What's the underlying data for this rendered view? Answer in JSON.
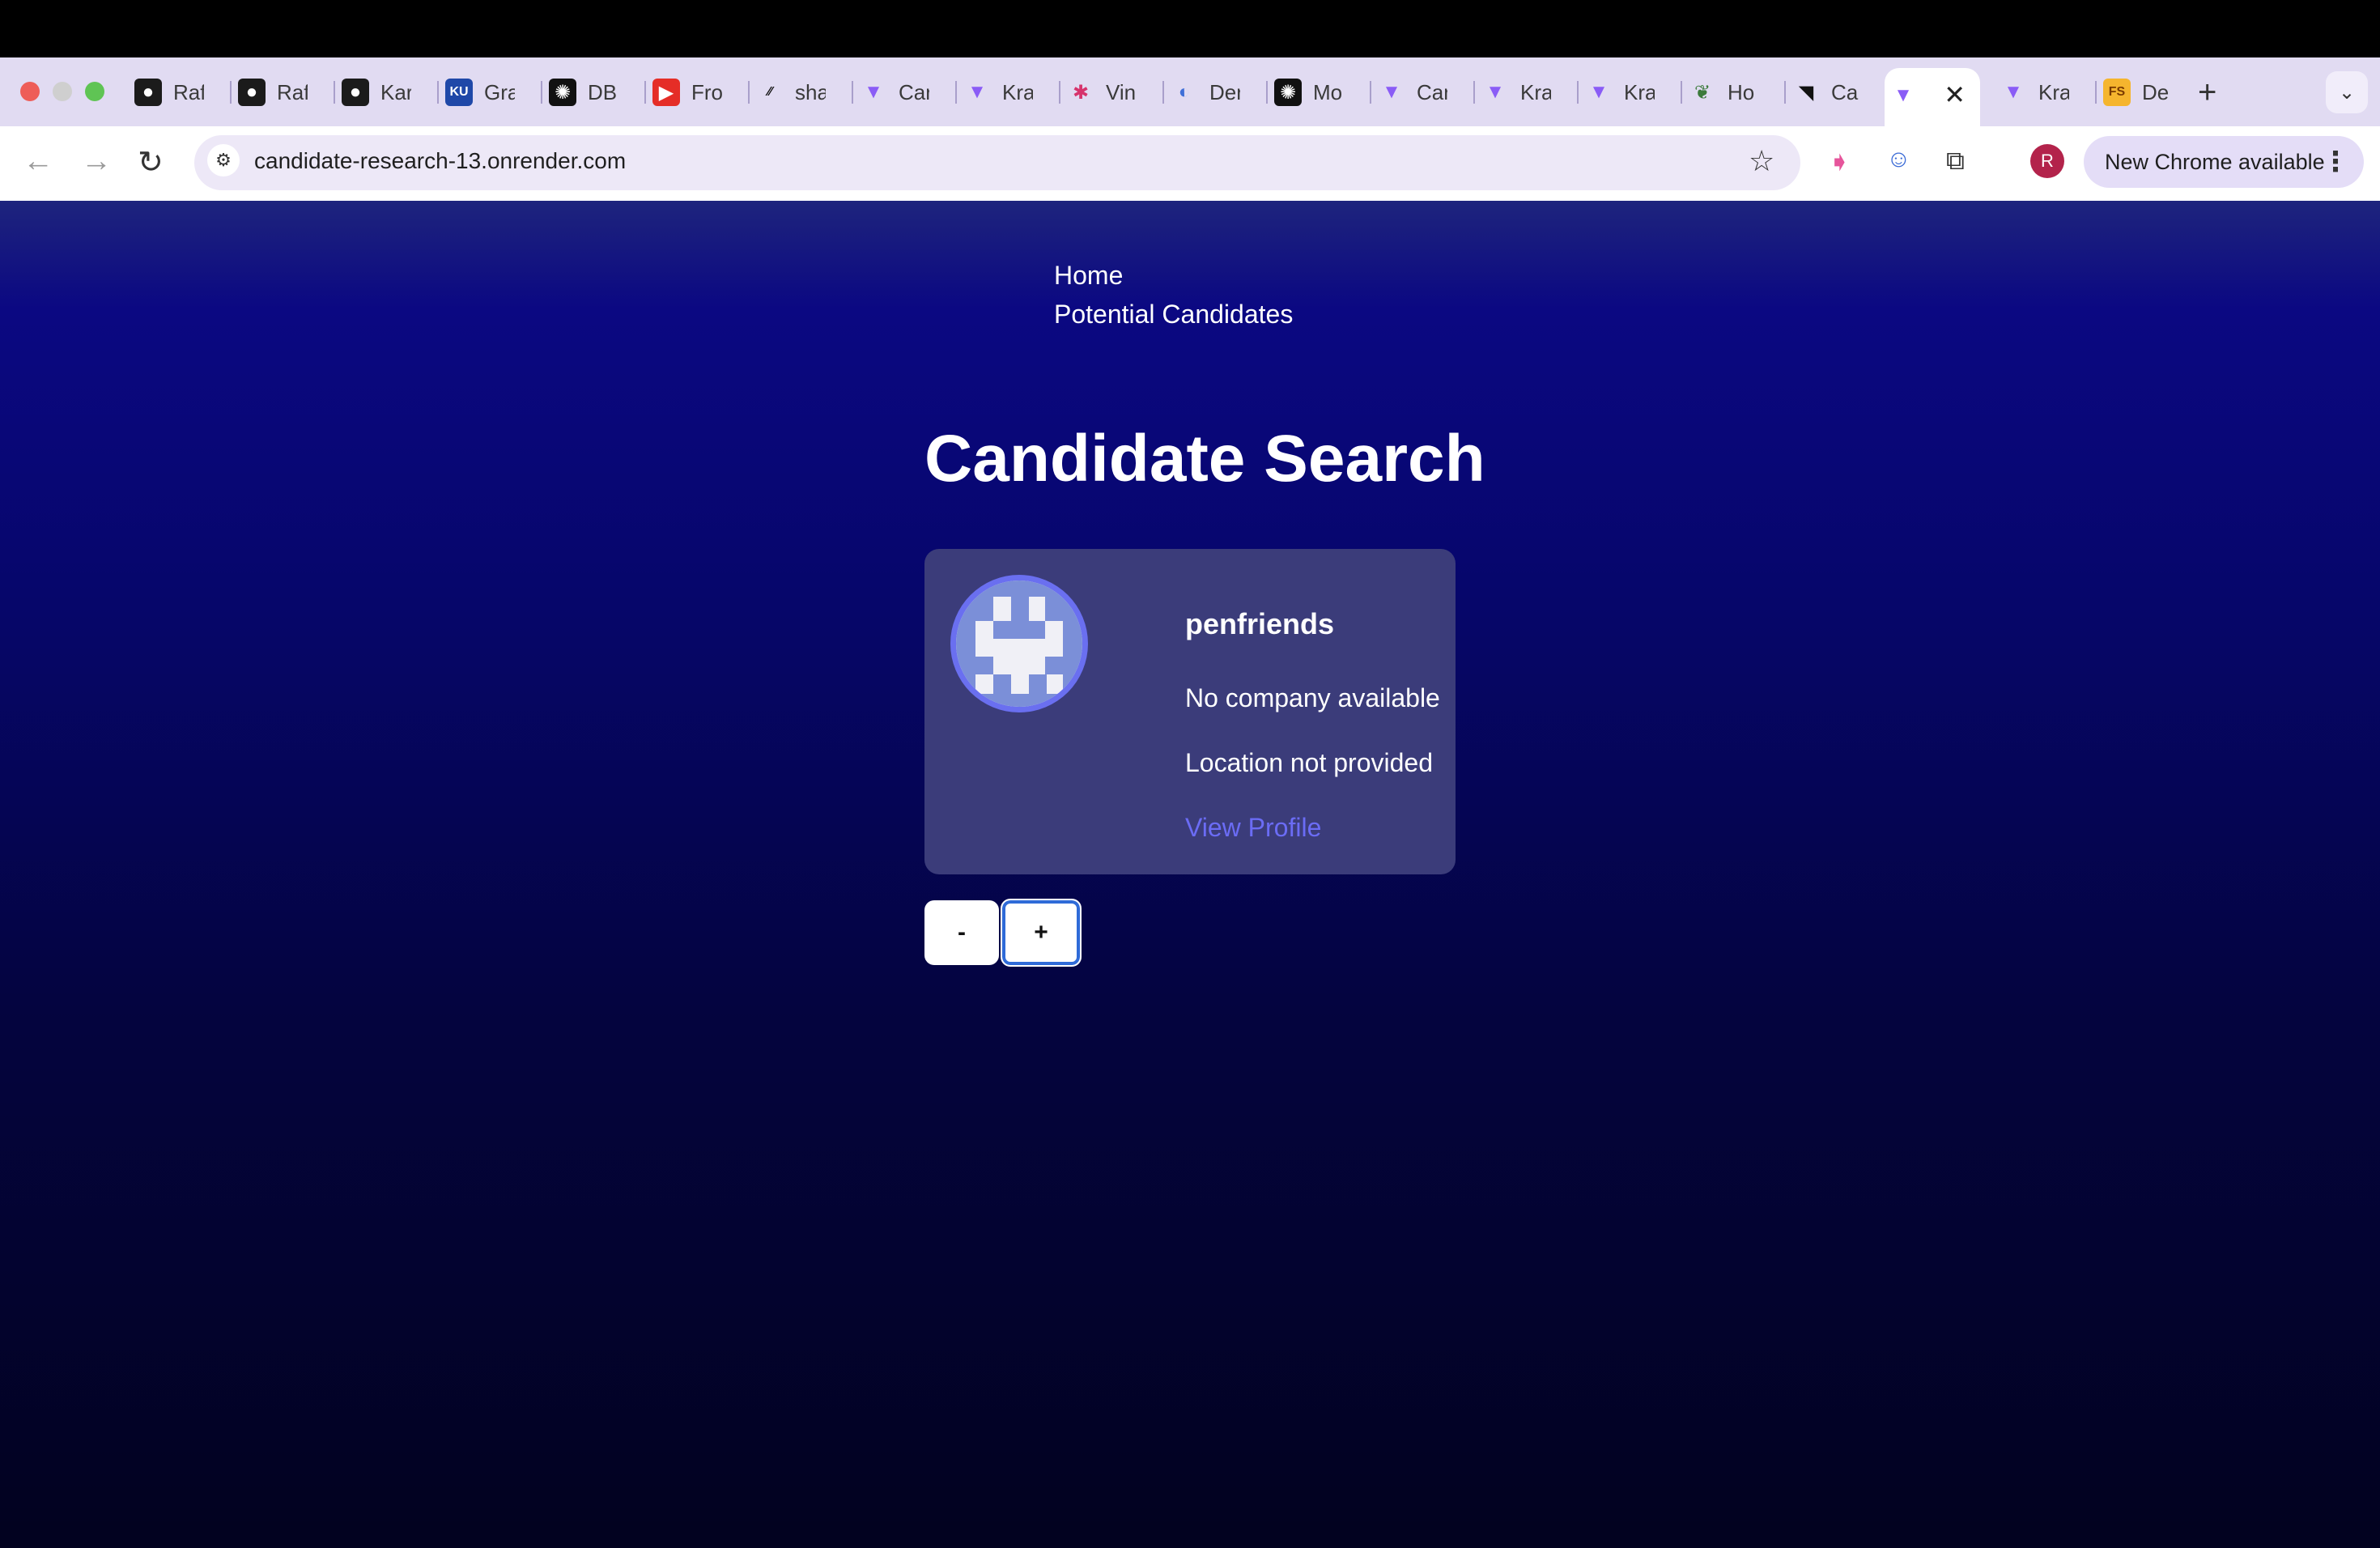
{
  "browser": {
    "tabs": [
      {
        "label": "Raf",
        "icon": "github-icon"
      },
      {
        "label": "Raf",
        "icon": "github-icon"
      },
      {
        "label": "Kar",
        "icon": "github-icon"
      },
      {
        "label": "Gra",
        "icon": "ku-icon"
      },
      {
        "label": "DB",
        "icon": "openai-icon"
      },
      {
        "label": "Fro",
        "icon": "youtube-icon"
      },
      {
        "label": "sha",
        "icon": "slash-icon"
      },
      {
        "label": "Car",
        "icon": "vite-icon"
      },
      {
        "label": "Kra",
        "icon": "vite-icon"
      },
      {
        "label": "Vin",
        "icon": "slack-icon"
      },
      {
        "label": "Der",
        "icon": "deno-icon"
      },
      {
        "label": "Mo",
        "icon": "openai-icon"
      },
      {
        "label": "Car",
        "icon": "vite-icon"
      },
      {
        "label": "Kra",
        "icon": "vite-icon"
      },
      {
        "label": "Kra",
        "icon": "vite-icon"
      },
      {
        "label": "Ho",
        "icon": "plant-icon"
      },
      {
        "label": "Ca",
        "icon": "render-icon"
      },
      {
        "label": "",
        "icon": "vite-icon"
      },
      {
        "label": "Kra",
        "icon": "vite-icon"
      },
      {
        "label": "De",
        "icon": "fs-icon"
      }
    ],
    "url": "candidate-research-13.onrender.com",
    "profile_initial": "R",
    "update_label": "New Chrome available",
    "colors": {
      "tabstrip": "#e1dbf2",
      "accent": "#6b6cf5"
    }
  },
  "nav": {
    "home": "Home",
    "potential": "Potential Candidates"
  },
  "page": {
    "title": "Candidate Search"
  },
  "candidate": {
    "username": "penfriends",
    "company": "No company available",
    "location": "Location not provided",
    "profile_link": "View Profile"
  },
  "buttons": {
    "reject": "-",
    "accept": "+"
  }
}
